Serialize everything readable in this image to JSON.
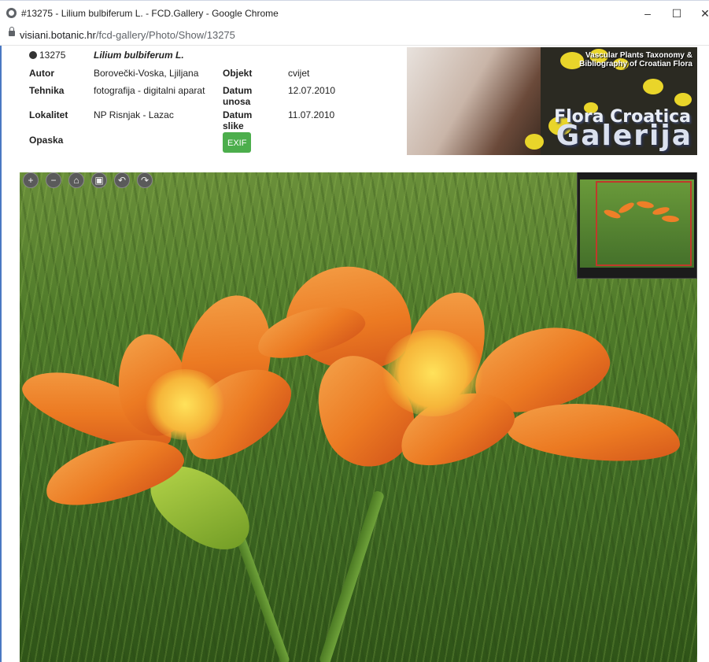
{
  "window": {
    "title": "#13275 - Lilium bulbiferum L. - FCD.Gallery - Google Chrome",
    "minimize_label": "–",
    "maximize_label": "☐",
    "close_label": "✕"
  },
  "address": {
    "host": "visiani.botanic.hr",
    "path": "/fcd-gallery/Photo/Show/13275"
  },
  "photo_info": {
    "id": "13275",
    "species": "Lilium bulbiferum L.",
    "author_label": "Autor",
    "author": "Borovečki-Voska, Ljiljana",
    "object_label": "Objekt",
    "object": "cvijet",
    "technique_label": "Tehnika",
    "technique": "fotografija - digitalni aparat",
    "entry_date_label": "Datum unosa",
    "entry_date": "12.07.2010",
    "locality_label": "Lokalitet",
    "locality": "NP Risnjak - Lazac",
    "photo_date_label": "Datum slike",
    "photo_date": "11.07.2010",
    "note_label": "Opaska",
    "exif_label": "EXIF"
  },
  "banner": {
    "line1": "Vascular Plants Taxonomy &",
    "line2": "Bibliography of Croatian Flora",
    "title1": "Flora Croatica",
    "title2": "Galerija"
  },
  "viewer": {
    "tools": [
      {
        "icon": "zoom-in-icon",
        "glyph": "+"
      },
      {
        "icon": "zoom-out-icon",
        "glyph": "−"
      },
      {
        "icon": "home-icon",
        "glyph": "⌂"
      },
      {
        "icon": "fullscreen-icon",
        "glyph": "▣"
      },
      {
        "icon": "rotate-left-icon",
        "glyph": "↶"
      },
      {
        "icon": "rotate-right-icon",
        "glyph": "↷"
      }
    ]
  },
  "colors": {
    "exif_button": "#4cae4c",
    "navigator_frame": "#c0392b",
    "window_accent": "#4a78c2"
  }
}
